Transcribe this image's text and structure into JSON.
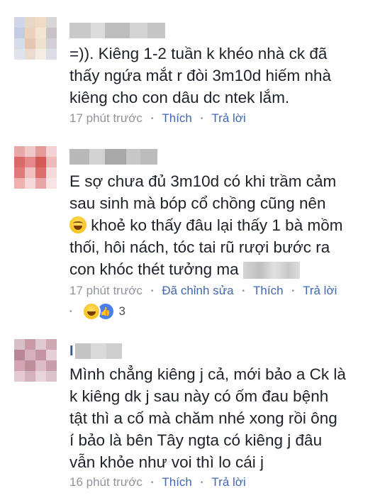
{
  "comments": [
    {
      "text": "=)). Kiêng 1-2 tuần k khéo nhà ck đã\nthấy ngứa mắt r đòi 3m10d hiếm nhà\nkiêng cho con dâu dc ntek lắm.",
      "time": "17 phút trước",
      "like_label": "Thích",
      "reply_label": "Trả lời"
    },
    {
      "text_before_emoji": "E sợ chưa đủ 3m10d có khi trầm cảm\nsau sinh mà bóp cổ chồng cũng nên\n",
      "text_after_emoji": " khoẻ ko thấy đâu lại thấy 1 bà mồm\nthối, hôi nách, tóc tai rũ rượi bước ra\ncon khóc thét tưởng ma ",
      "emoji_icon": "laughing-tears-emoji",
      "time": "17 phút trước",
      "edited_label": "Đã chỉnh sửa",
      "like_label": "Thích",
      "reply_label": "Trả lời",
      "reaction_count": "3",
      "reaction_icons": [
        "haha-reaction-icon",
        "like-reaction-icon"
      ]
    },
    {
      "text": "Mình chẳng kiêng j cả, mới bảo a Ck là\nk kiêng dk j sau này có ốm đau bệnh\ntật thì a cố mà chăm nhé xong rồi ông\ní bảo là bên Tây ngta có kiêng j đâu\nvẫn khỏe như voi thì lo cái j",
      "name_initial": "I",
      "time": "16 phút trước",
      "like_label": "Thích",
      "reply_label": "Trả lời"
    }
  ],
  "colors": {
    "text": "#1d2129",
    "meta_gray": "#90949c",
    "link_blue": "#4267b2"
  }
}
